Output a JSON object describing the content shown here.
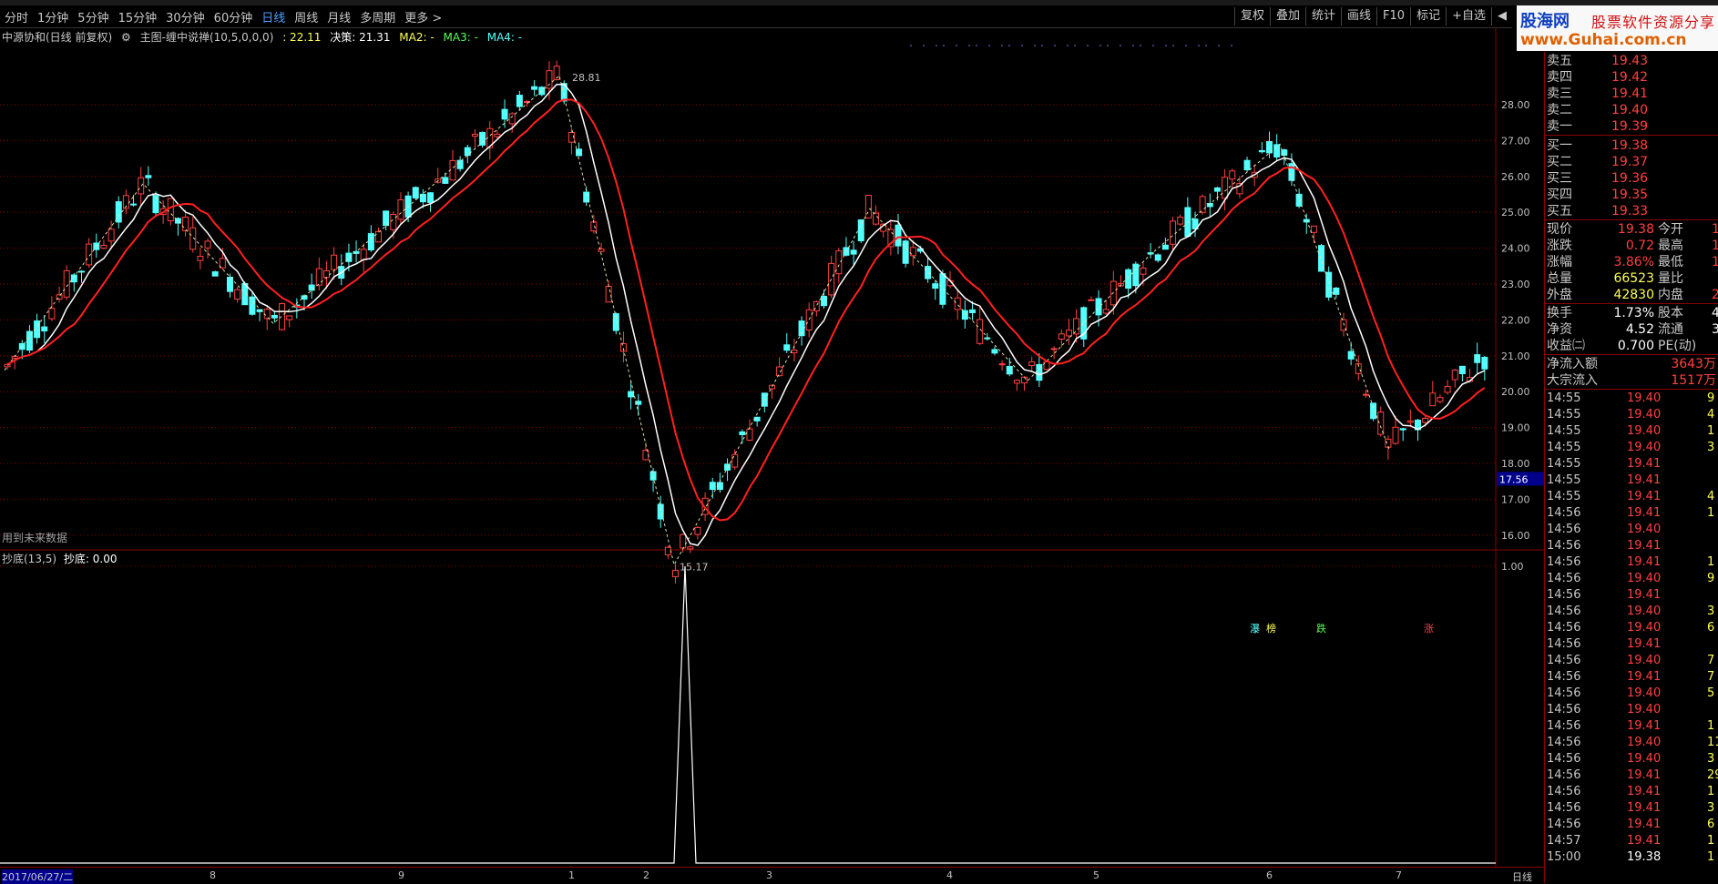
{
  "toolbar": {
    "periods": [
      "分时",
      "1分钟",
      "5分钟",
      "15分钟",
      "30分钟",
      "60分钟",
      "日线",
      "周线",
      "月线",
      "多周期",
      "更多 >"
    ],
    "active_period": "日线",
    "right_buttons": [
      "复权",
      "叠加",
      "统计",
      "画线",
      "F10",
      "标记",
      "+自选",
      "◀"
    ]
  },
  "logo": {
    "line1": "股海网",
    "line2": "股票软件资源分享",
    "line3": "www.Guhai.com.cn"
  },
  "chart_header": {
    "stock": "中源协和(日线 前复权)",
    "indicator": "主图-缠中说禅(10,5,0,0,0)",
    "v1": ": 22.11",
    "v2": "决策: 21.31",
    "ma2": "MA2: -",
    "ma3": "MA3: -",
    "ma4": "MA4: -"
  },
  "main_chart": {
    "price_labels": [
      "28.00",
      "27.00",
      "26.00",
      "25.00",
      "24.00",
      "23.00",
      "22.00",
      "21.00",
      "20.00",
      "19.00",
      "18.00",
      "17.00",
      "16.00"
    ],
    "current_price_label": "17.56",
    "high_marker": "28.81",
    "low_marker": "15.17",
    "future_note": "用到未来数据",
    "signals": [
      "瀑",
      "榜",
      "跌",
      "涨"
    ]
  },
  "sub_chart": {
    "title": "抄底(13,5)",
    "value": "抄底: 0.00",
    "axis_label": "1.00"
  },
  "date_bar": {
    "start": "2017/06/27/二",
    "months": [
      "8",
      "9",
      "1",
      "2",
      "3",
      "4",
      "5",
      "6",
      "7"
    ],
    "period": "日线"
  },
  "quote": {
    "asks": [
      {
        "label": "卖五",
        "price": "19.43"
      },
      {
        "label": "卖四",
        "price": "19.42"
      },
      {
        "label": "卖三",
        "price": "19.41"
      },
      {
        "label": "卖二",
        "price": "19.40"
      },
      {
        "label": "卖一",
        "price": "19.39"
      }
    ],
    "bids": [
      {
        "label": "买一",
        "price": "19.38"
      },
      {
        "label": "买二",
        "price": "19.37"
      },
      {
        "label": "买三",
        "price": "19.36"
      },
      {
        "label": "买四",
        "price": "19.35"
      },
      {
        "label": "买五",
        "price": "19.33"
      }
    ],
    "stats": [
      {
        "l1": "现价",
        "v1": "19.38",
        "l2": "今开",
        "v2": "1"
      },
      {
        "l1": "涨跌",
        "v1": "0.72",
        "l2": "最高",
        "v2": "1"
      },
      {
        "l1": "涨幅",
        "v1": "3.86%",
        "l2": "最低",
        "v2": "1"
      },
      {
        "l1": "总量",
        "v1": "66523",
        "l2": "量比",
        "v2": ""
      },
      {
        "l1": "外盘",
        "v1": "42830",
        "l2": "内盘",
        "v2": "2"
      }
    ],
    "stats2": [
      {
        "l1": "换手",
        "v1": "1.73%",
        "l2": "股本",
        "v2": "4."
      },
      {
        "l1": "净资",
        "v1": "4.52",
        "l2": "流通",
        "v2": "3."
      },
      {
        "l1": "收益㈡",
        "v1": "0.700",
        "l2": "PE(动)",
        "v2": ""
      }
    ],
    "flows": [
      {
        "label": "净流入额",
        "value": "3643万"
      },
      {
        "label": "大宗流入",
        "value": "1517万"
      }
    ],
    "ticks": [
      {
        "t": "14:55",
        "p": "19.40",
        "v": "9"
      },
      {
        "t": "14:55",
        "p": "19.40",
        "v": "4"
      },
      {
        "t": "14:55",
        "p": "19.40",
        "v": "1"
      },
      {
        "t": "14:55",
        "p": "19.40",
        "v": "3"
      },
      {
        "t": "14:55",
        "p": "19.41",
        "v": ""
      },
      {
        "t": "14:55",
        "p": "19.41",
        "v": ""
      },
      {
        "t": "14:55",
        "p": "19.41",
        "v": "4"
      },
      {
        "t": "14:56",
        "p": "19.41",
        "v": "1"
      },
      {
        "t": "14:56",
        "p": "19.40",
        "v": ""
      },
      {
        "t": "14:56",
        "p": "19.41",
        "v": ""
      },
      {
        "t": "14:56",
        "p": "19.41",
        "v": "1"
      },
      {
        "t": "14:56",
        "p": "19.40",
        "v": "9"
      },
      {
        "t": "14:56",
        "p": "19.41",
        "v": ""
      },
      {
        "t": "14:56",
        "p": "19.40",
        "v": "3"
      },
      {
        "t": "14:56",
        "p": "19.40",
        "v": "6"
      },
      {
        "t": "14:56",
        "p": "19.41",
        "v": ""
      },
      {
        "t": "14:56",
        "p": "19.40",
        "v": "7"
      },
      {
        "t": "14:56",
        "p": "19.41",
        "v": "7"
      },
      {
        "t": "14:56",
        "p": "19.40",
        "v": "5"
      },
      {
        "t": "14:56",
        "p": "19.40",
        "v": ""
      },
      {
        "t": "14:56",
        "p": "19.41",
        "v": "1"
      },
      {
        "t": "14:56",
        "p": "19.40",
        "v": "11"
      },
      {
        "t": "14:56",
        "p": "19.40",
        "v": "3"
      },
      {
        "t": "14:56",
        "p": "19.41",
        "v": "29"
      },
      {
        "t": "14:56",
        "p": "19.41",
        "v": "1"
      },
      {
        "t": "14:56",
        "p": "19.41",
        "v": "3"
      },
      {
        "t": "14:56",
        "p": "19.41",
        "v": "6"
      },
      {
        "t": "14:57",
        "p": "19.41",
        "v": "1"
      },
      {
        "t": "15:00",
        "p": "19.38",
        "v": "1"
      }
    ]
  },
  "colors": {
    "up": "#ff4040",
    "down": "#54ffff",
    "ma": "#ffffff",
    "ma2": "#ff2020",
    "grid": "#8b0000",
    "price": "#ff4040"
  }
}
